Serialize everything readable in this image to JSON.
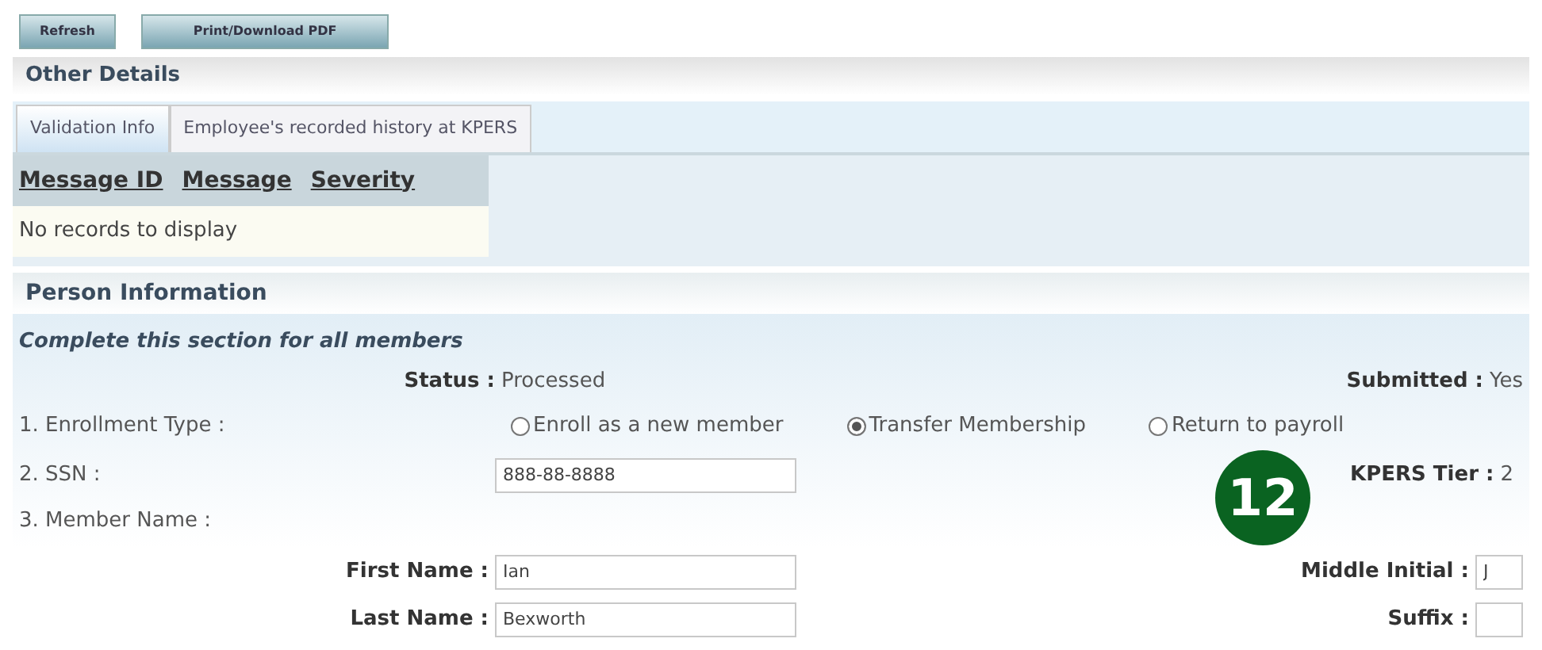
{
  "toolbar": {
    "buttons": [
      "Refresh",
      "Print/Download PDF"
    ]
  },
  "other_details": {
    "title": "Other Details",
    "tabs": [
      {
        "label": "Validation Info",
        "selected": true
      },
      {
        "label": "Employee's recorded history at KPERS",
        "selected": false
      }
    ],
    "grid": {
      "columns": [
        "Message ID",
        "Message",
        "Severity"
      ],
      "empty_text": "No records to display"
    }
  },
  "person_information": {
    "title": "Person Information",
    "subtitle": "Complete this section for all members",
    "status": {
      "label": "Status :",
      "value": "Processed"
    },
    "submitted": {
      "label": "Submitted :",
      "value": "Yes"
    },
    "enrollment_type": {
      "label": "1. Enrollment Type :",
      "options": [
        {
          "label": "Enroll as a new member",
          "selected": false
        },
        {
          "label": "Transfer Membership",
          "selected": true
        },
        {
          "label": "Return to payroll",
          "selected": false
        }
      ]
    },
    "ssn": {
      "label": "2. SSN :",
      "value": "888-88-8888"
    },
    "kpers_tier": {
      "label": "KPERS Tier :",
      "value": "2"
    },
    "member_name": {
      "label": "3. Member Name :"
    },
    "first_name": {
      "label": "First Name :",
      "value": "Ian"
    },
    "middle_initial": {
      "label": "Middle Initial :",
      "value": "J"
    },
    "last_name": {
      "label": "Last Name :",
      "value": "Bexworth"
    },
    "suffix": {
      "label": "Suffix :"
    }
  },
  "callout": {
    "number": "12"
  }
}
